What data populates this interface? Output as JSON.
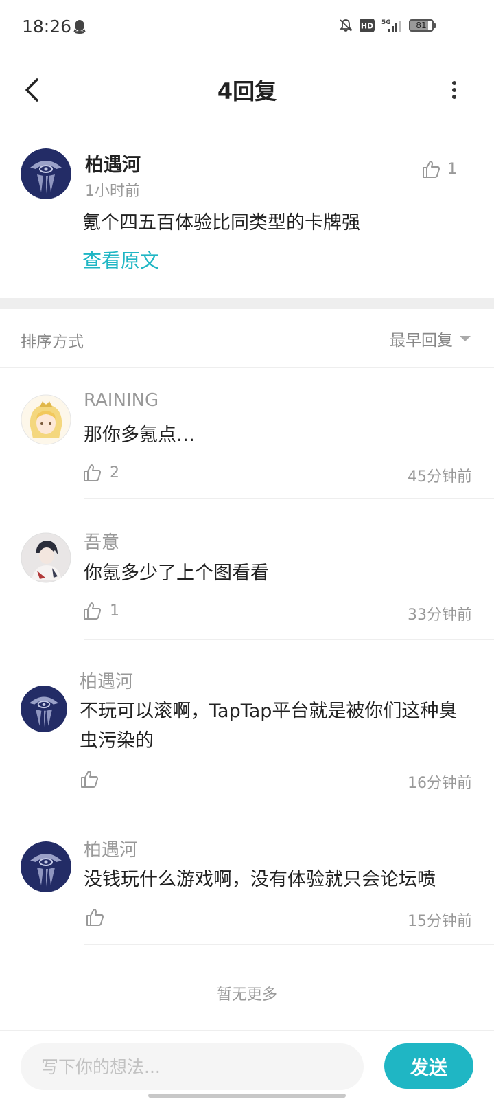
{
  "status_bar": {
    "time": "18:26",
    "network": "5G",
    "hd": "HD",
    "battery": "81"
  },
  "header": {
    "title": "4回复"
  },
  "post": {
    "author": "柏遇河",
    "time": "1小时前",
    "like_count": "1",
    "text": "氪个四五百体验比同类型的卡牌强",
    "view_original": "查看原文"
  },
  "sort": {
    "label": "排序方式",
    "selected": "最早回复"
  },
  "replies": [
    {
      "author": "RAINING",
      "text": "那你多氪点…",
      "likes": "2",
      "time": "45分钟前"
    },
    {
      "author": "吾意",
      "text": "你氪多少了上个图看看",
      "likes": "1",
      "time": "33分钟前"
    },
    {
      "author": "柏遇河",
      "text": "不玩可以滚啊，TapTap平台就是被你们这种臭虫污染的",
      "likes": "",
      "time": "16分钟前"
    },
    {
      "author": "柏遇河",
      "text": "没钱玩什么游戏啊，没有体验就只会论坛喷",
      "likes": "",
      "time": "15分钟前"
    }
  ],
  "footer": {
    "no_more": "暂无更多"
  },
  "composer": {
    "placeholder": "写下你的想法...",
    "send_label": "发送"
  },
  "colors": {
    "accent": "#1fb6c4",
    "muted": "#999999"
  }
}
